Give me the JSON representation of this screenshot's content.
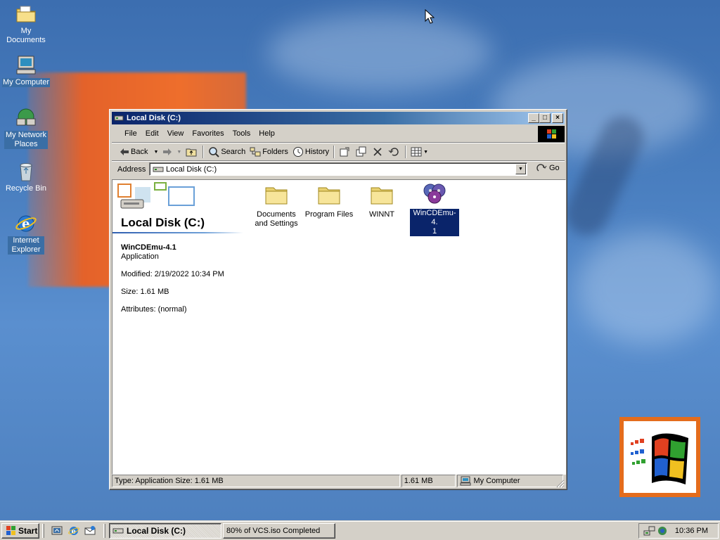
{
  "desktop": {
    "icons": [
      {
        "label": "My Documents",
        "icon": "my-documents-icon"
      },
      {
        "label": "My Computer",
        "icon": "my-computer-icon"
      },
      {
        "label": "My Network Places",
        "icon": "network-places-icon"
      },
      {
        "label": "Recycle Bin",
        "icon": "recycle-bin-icon"
      },
      {
        "label": "Internet Explorer",
        "icon": "internet-explorer-icon"
      }
    ]
  },
  "window": {
    "title": "Local Disk (C:)",
    "caption_buttons": {
      "minimize": "_",
      "maximize": "□",
      "close": "×"
    },
    "menu": [
      "File",
      "Edit",
      "View",
      "Favorites",
      "Tools",
      "Help"
    ],
    "toolbar": {
      "back": "Back",
      "search": "Search",
      "folders": "Folders",
      "history": "History"
    },
    "address": {
      "label": "Address",
      "value": "Local Disk (C:)",
      "go": "Go"
    },
    "left_pane": {
      "title": "Local Disk (C:)",
      "selected_name": "WinCDEmu-4.1",
      "selected_type": "Application",
      "modified": "Modified: 2/19/2022 10:34 PM",
      "size": "Size: 1.61 MB",
      "attributes": "Attributes: (normal)"
    },
    "items": [
      {
        "label_line1": "Documents",
        "label_line2": "and Settings",
        "icon": "folder-icon"
      },
      {
        "label_line1": "Program Files",
        "label_line2": "",
        "icon": "folder-icon"
      },
      {
        "label_line1": "WINNT",
        "label_line2": "",
        "icon": "folder-icon"
      },
      {
        "label_line1": "WinCDEmu-4.",
        "label_line2": "1",
        "icon": "cd-discs-icon",
        "selected": true
      }
    ],
    "status": {
      "info": "Type: Application Size: 1.61 MB",
      "size": "1.61 MB",
      "zone": "My Computer"
    }
  },
  "taskbar": {
    "start": "Start",
    "tasks": [
      {
        "label": "Local Disk (C:)",
        "active": true
      },
      {
        "label": "80% of VCS.iso Completed",
        "active": false
      }
    ],
    "clock": "10:36 PM"
  },
  "colors": {
    "title_active": "#0a246a",
    "face": "#d4d0c8",
    "desktop": "#3a6ea5",
    "accent_orange": "#e4622a"
  }
}
